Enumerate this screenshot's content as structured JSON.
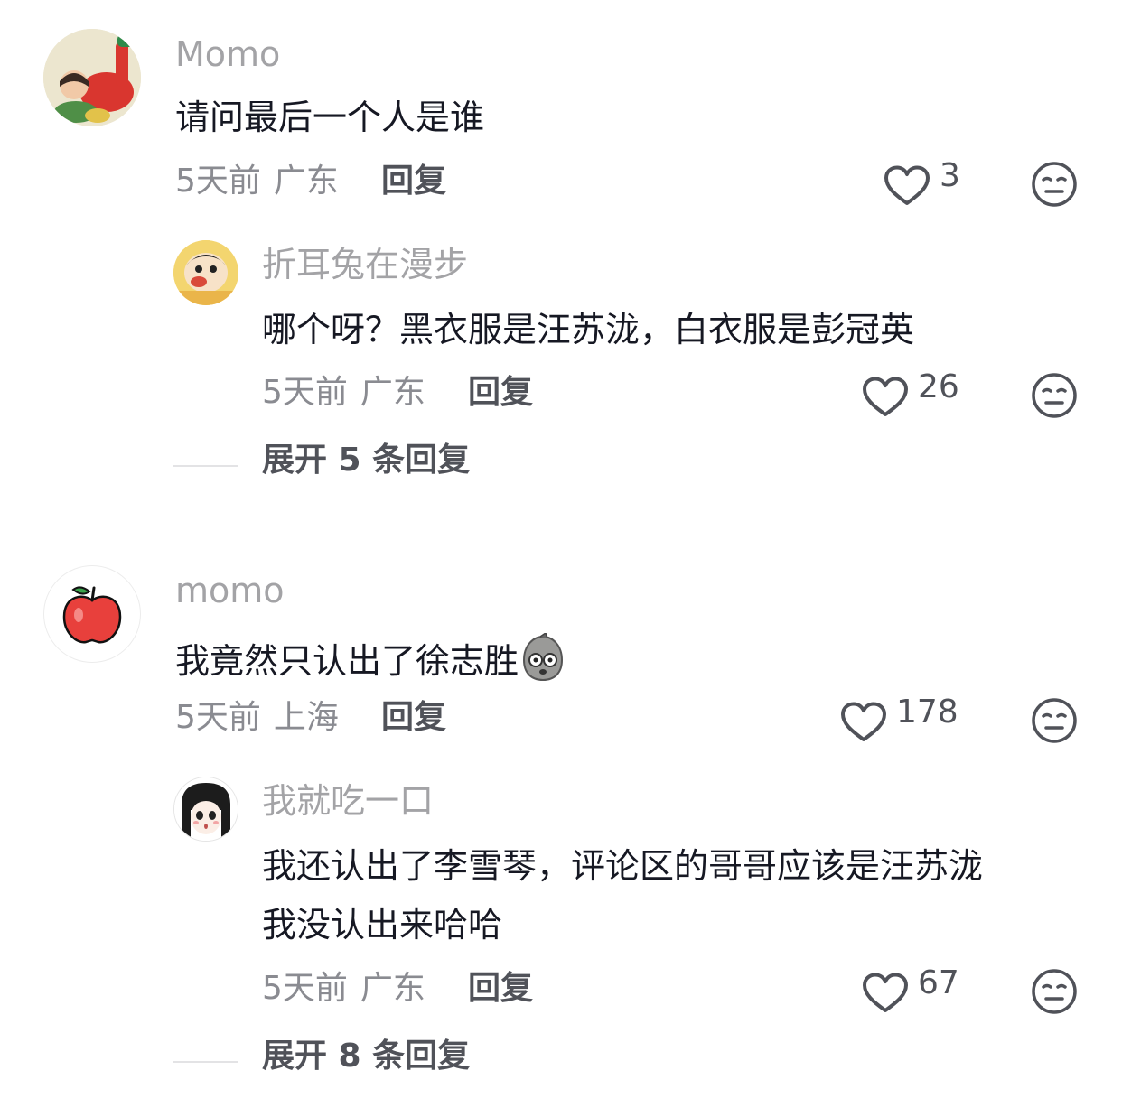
{
  "comments": [
    {
      "username": "Momo",
      "text": "请问最后一个人是谁",
      "time": "5天前",
      "location": "广东",
      "reply_label": "回复",
      "likes": "3",
      "replies": [
        {
          "username": "折耳兔在漫步",
          "text": "哪个呀？黑衣服是汪苏泷，白衣服是彭冠英",
          "time": "5天前",
          "location": "广东",
          "reply_label": "回复",
          "likes": "26"
        }
      ],
      "expand_label": "展开 5 条回复"
    },
    {
      "username": "momo",
      "text": "我竟然只认出了徐志胜",
      "time": "5天前",
      "location": "上海",
      "reply_label": "回复",
      "likes": "178",
      "replies": [
        {
          "username": "我就吃一口",
          "text_line1": "我还认出了李雪琴，评论区的哥哥应该是汪苏泷",
          "text_line2": "我没认出来哈哈",
          "time": "5天前",
          "location": "广东",
          "reply_label": "回复",
          "likes": "67"
        }
      ],
      "expand_label": "展开 8 条回复"
    }
  ],
  "icons": {
    "like": "heart-outline-icon",
    "dislike": "neutral-face-icon",
    "emoji": "potato-emoji-icon"
  },
  "colors": {
    "username": "#a3a3a6",
    "text": "#161823",
    "meta": "#8a8b91",
    "action": "#505259"
  }
}
